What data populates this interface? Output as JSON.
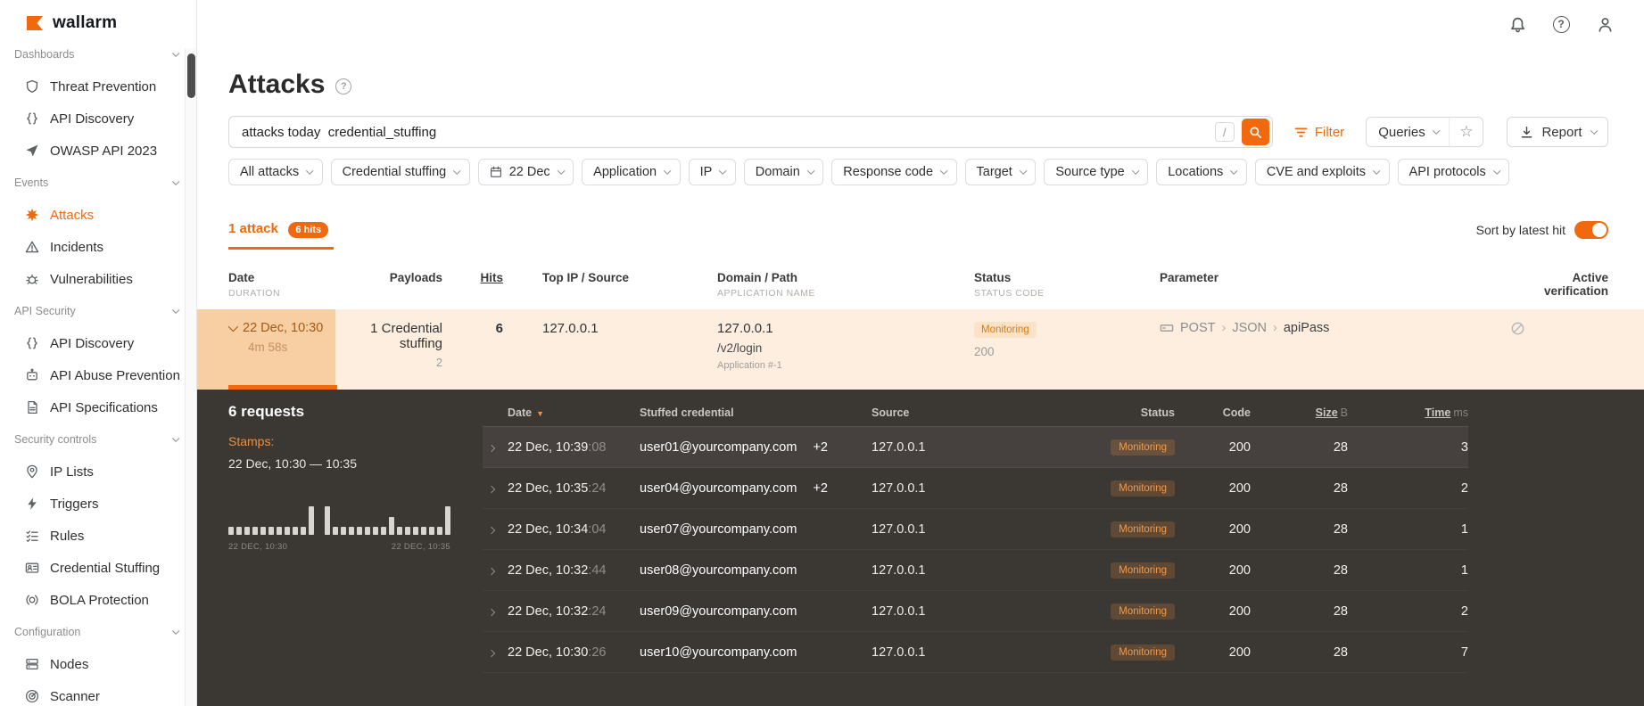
{
  "brand": {
    "name": "wallarm"
  },
  "colors": {
    "accent": "#f0690e",
    "panel_dark": "#3b3733",
    "monitoring_text": "#db7912"
  },
  "header": {
    "title": "Attacks"
  },
  "search": {
    "value": "attacks today  credential_stuffing",
    "shortcut_hint": "/"
  },
  "toolbar": {
    "filter_label": "Filter",
    "queries_label": "Queries",
    "report_label": "Report"
  },
  "filters": {
    "chips": [
      {
        "label": "All attacks"
      },
      {
        "label": "Credential stuffing"
      },
      {
        "label": "22 Dec"
      },
      {
        "label": "Application"
      },
      {
        "label": "IP"
      },
      {
        "label": "Domain"
      },
      {
        "label": "Response code"
      },
      {
        "label": "Target"
      },
      {
        "label": "Source type"
      },
      {
        "label": "Locations"
      },
      {
        "label": "CVE and exploits"
      },
      {
        "label": "API protocols"
      }
    ]
  },
  "results": {
    "count_label": "1 attack",
    "hits_badge": "6 hits",
    "sort_label": "Sort by latest hit",
    "sort_enabled": true
  },
  "sidebar": {
    "sections": [
      {
        "label": "Dashboards",
        "items": [
          {
            "label": "Threat Prevention"
          },
          {
            "label": "API Discovery"
          },
          {
            "label": "OWASP API 2023"
          }
        ]
      },
      {
        "label": "Events",
        "items": [
          {
            "label": "Attacks",
            "active": true
          },
          {
            "label": "Incidents"
          },
          {
            "label": "Vulnerabilities"
          }
        ]
      },
      {
        "label": "API Security",
        "items": [
          {
            "label": "API Discovery"
          },
          {
            "label": "API Abuse Prevention"
          },
          {
            "label": "API Specifications"
          }
        ]
      },
      {
        "label": "Security controls",
        "items": [
          {
            "label": "IP Lists"
          },
          {
            "label": "Triggers"
          },
          {
            "label": "Rules"
          },
          {
            "label": "Credential Stuffing"
          },
          {
            "label": "BOLA Protection"
          }
        ]
      },
      {
        "label": "Configuration",
        "items": [
          {
            "label": "Nodes"
          },
          {
            "label": "Scanner"
          }
        ]
      }
    ]
  },
  "attacks_table": {
    "headers": {
      "date": "Date",
      "date_sub": "DURATION",
      "payloads": "Payloads",
      "hits": "Hits",
      "top_ip": "Top IP / Source",
      "domain": "Domain / Path",
      "domain_sub": "APPLICATION NAME",
      "status": "Status",
      "status_sub": "STATUS CODE",
      "parameter": "Parameter",
      "verification_line1": "Active",
      "verification_line2": "verification"
    },
    "row": {
      "date": "22 Dec, 10:30",
      "duration": "4m 58s",
      "payloads": "1 Credential stuffing",
      "payloads_count": "2",
      "hits": "6",
      "top_ip": "127.0.0.1",
      "domain": "127.0.0.1",
      "path": "/v2/login",
      "application": "Application #-1",
      "status": "Monitoring",
      "status_code": "200",
      "parameter_method": "POST",
      "parameter_sep1": "›",
      "parameter_type": "JSON",
      "parameter_sep2": "›",
      "parameter_name": "apiPass"
    }
  },
  "detail": {
    "requests_label": "6 requests",
    "stamps_label": "Stamps:",
    "stamps_range": "22 Dec, 10:30 — 10:35",
    "chart_data": {
      "type": "bar",
      "x_start_label": "22 DEC, 10:30",
      "x_end_label": "22 DEC, 10:35",
      "values": [
        1,
        1,
        1,
        1,
        1,
        1,
        1,
        1,
        1,
        1,
        3,
        0,
        3,
        1,
        1,
        1,
        1,
        1,
        1,
        1,
        2,
        1,
        1,
        1,
        1,
        1,
        1,
        3
      ]
    },
    "table": {
      "headers": {
        "date": "Date",
        "credential": "Stuffed credential",
        "source": "Source",
        "status": "Status",
        "code": "Code",
        "size": "Size",
        "size_unit": "B",
        "time": "Time",
        "time_unit": "ms"
      },
      "rows": [
        {
          "date": "22 Dec, 10:39",
          "seconds": ":08",
          "credential": "user01@yourcompany.com",
          "extra": "+2",
          "source": "127.0.0.1",
          "status": "Monitoring",
          "code": "200",
          "size": "28",
          "time": "3"
        },
        {
          "date": "22 Dec, 10:35",
          "seconds": ":24",
          "credential": "user04@yourcompany.com",
          "extra": "+2",
          "source": "127.0.0.1",
          "status": "Monitoring",
          "code": "200",
          "size": "28",
          "time": "2"
        },
        {
          "date": "22 Dec, 10:34",
          "seconds": ":04",
          "credential": "user07@yourcompany.com",
          "extra": "",
          "source": "127.0.0.1",
          "status": "Monitoring",
          "code": "200",
          "size": "28",
          "time": "1"
        },
        {
          "date": "22 Dec, 10:32",
          "seconds": ":44",
          "credential": "user08@yourcompany.com",
          "extra": "",
          "source": "127.0.0.1",
          "status": "Monitoring",
          "code": "200",
          "size": "28",
          "time": "1"
        },
        {
          "date": "22 Dec, 10:32",
          "seconds": ":24",
          "credential": "user09@yourcompany.com",
          "extra": "",
          "source": "127.0.0.1",
          "status": "Monitoring",
          "code": "200",
          "size": "28",
          "time": "2"
        },
        {
          "date": "22 Dec, 10:30",
          "seconds": ":26",
          "credential": "user10@yourcompany.com",
          "extra": "",
          "source": "127.0.0.1",
          "status": "Monitoring",
          "code": "200",
          "size": "28",
          "time": "7"
        }
      ]
    }
  }
}
